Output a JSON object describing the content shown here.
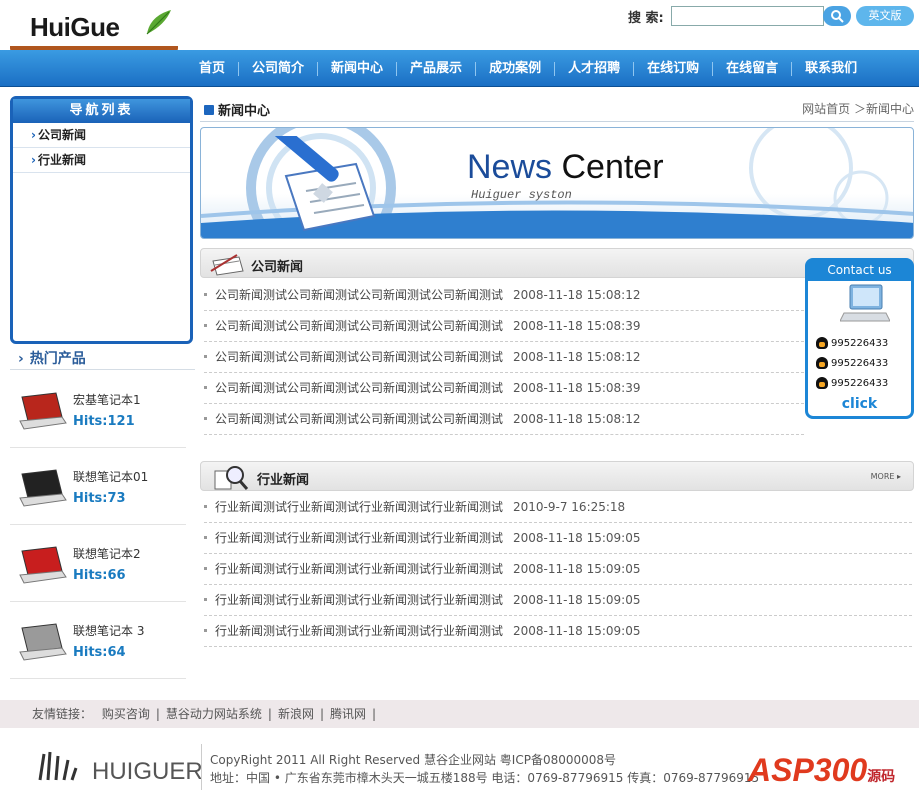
{
  "header": {
    "logo_text": "HuiGue",
    "search_label": "搜 索:",
    "search_value": "",
    "lang_button": "英文版"
  },
  "nav": [
    "首页",
    "公司简介",
    "新闻中心",
    "产品展示",
    "成功案例",
    "人才招聘",
    "在线订购",
    "在线留言",
    "联系我们"
  ],
  "sidebar": {
    "title": "导航列表",
    "items": [
      {
        "label": "公司新闻"
      },
      {
        "label": "行业新闻"
      }
    ]
  },
  "hot_products": {
    "title": "热门产品",
    "items": [
      {
        "name": "宏基笔记本1",
        "hits": "Hits:121",
        "color": "#b8261c"
      },
      {
        "name": "联想笔记本01",
        "hits": "Hits:73",
        "color": "#222222"
      },
      {
        "name": "联想笔记本2",
        "hits": "Hits:66",
        "color": "#c81e1e"
      },
      {
        "name": "联想笔记本 3",
        "hits": "Hits:64",
        "color": "#9a9a9a"
      }
    ]
  },
  "breadcrumb": {
    "title": "新闻中心",
    "path": "网站首页 ＞新闻中心"
  },
  "banner": {
    "title_part1": "News",
    "title_part2": "Center",
    "subtitle": "Huiguer syston"
  },
  "company_news": {
    "title": "公司新闻",
    "items": [
      {
        "text": "公司新闻测试公司新闻测试公司新闻测试公司新闻测试",
        "date": "2008-11-18 15:08:12"
      },
      {
        "text": "公司新闻测试公司新闻测试公司新闻测试公司新闻测试",
        "date": "2008-11-18 15:08:39"
      },
      {
        "text": "公司新闻测试公司新闻测试公司新闻测试公司新闻测试",
        "date": "2008-11-18 15:08:12"
      },
      {
        "text": "公司新闻测试公司新闻测试公司新闻测试公司新闻测试",
        "date": "2008-11-18 15:08:39"
      },
      {
        "text": "公司新闻测试公司新闻测试公司新闻测试公司新闻测试",
        "date": "2008-11-18 15:08:12"
      }
    ]
  },
  "industry_news": {
    "title": "行业新闻",
    "more": "MORE ▸",
    "items": [
      {
        "text": "行业新闻测试行业新闻测试行业新闻测试行业新闻测试",
        "date": "2010-9-7 16:25:18"
      },
      {
        "text": "行业新闻测试行业新闻测试行业新闻测试行业新闻测试",
        "date": "2008-11-18 15:09:05"
      },
      {
        "text": "行业新闻测试行业新闻测试行业新闻测试行业新闻测试",
        "date": "2008-11-18 15:09:05"
      },
      {
        "text": "行业新闻测试行业新闻测试行业新闻测试行业新闻测试",
        "date": "2008-11-18 15:09:05"
      },
      {
        "text": "行业新闻测试行业新闻测试行业新闻测试行业新闻测试",
        "date": "2008-11-18 15:09:05"
      }
    ]
  },
  "contact": {
    "title": "Contact us",
    "qq": [
      "995226433",
      "995226433",
      "995226433"
    ],
    "click": "click"
  },
  "links": {
    "label": "友情链接：",
    "items": [
      "购买咨询",
      "慧谷动力网站系统",
      "新浪网",
      "腾讯网"
    ]
  },
  "footer": {
    "logo_name": "HUIGUER",
    "copyright": "CopyRight 2011 All Right Reserved 慧谷企业网站 粤ICP备08000008号",
    "address": "地址：中国 • 广东省东莞市樟木头天一城五楼188号 电话：0769-87796915 传真：0769-87796915"
  },
  "watermark": {
    "text": "ASP300",
    "sub": "源码"
  },
  "colors": {
    "nav": "#1b6fc4",
    "accent": "#1a62b8",
    "hits": "#1a7bc0"
  }
}
